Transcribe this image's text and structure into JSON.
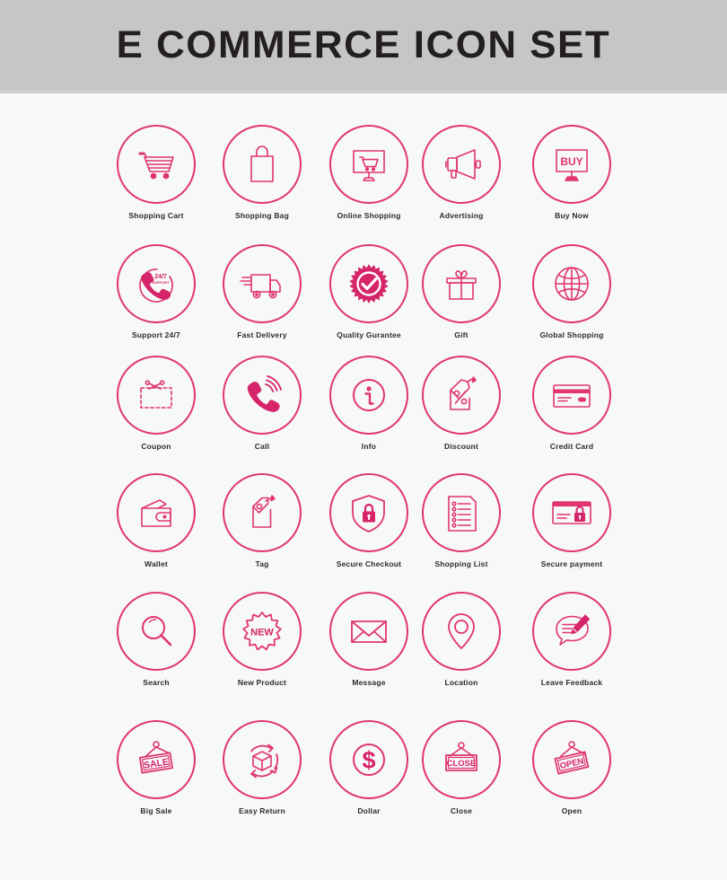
{
  "header": {
    "title": "E COMMERCE ICON SET",
    "background_color": "#c6c6c6",
    "text_color": "#231f20"
  },
  "theme": {
    "accent_color": "#e0356f",
    "accent_dark": "#d6246a",
    "page_background": "#f7f8f8",
    "label_color": "#2b2b2b"
  },
  "grid": {
    "columns": 5,
    "rows": 6,
    "column_centers": [
      174,
      292,
      411,
      514,
      637
    ],
    "row_centers": [
      185,
      318,
      442,
      573,
      705,
      848
    ]
  },
  "icons": [
    {
      "id": "shopping-cart",
      "label": "Shopping Cart",
      "icon": "cart-icon",
      "row": 0,
      "col": 0
    },
    {
      "id": "shopping-bag",
      "label": "Shopping Bag",
      "icon": "bag-icon",
      "row": 0,
      "col": 1
    },
    {
      "id": "online-shopping",
      "label": "Online Shopping",
      "icon": "monitor-cart-icon",
      "row": 0,
      "col": 2
    },
    {
      "id": "advertising",
      "label": "Advertising",
      "icon": "megaphone-icon",
      "row": 0,
      "col": 3
    },
    {
      "id": "buy-now",
      "label": "Buy Now",
      "icon": "monitor-buy-icon",
      "row": 0,
      "col": 4,
      "inner_text": "BUY"
    },
    {
      "id": "support-24-7",
      "label": "Support 24/7",
      "icon": "phone-support-icon",
      "row": 1,
      "col": 0,
      "inner_text": "24/7",
      "inner_text_2": "SUPPORT"
    },
    {
      "id": "fast-delivery",
      "label": "Fast Delivery",
      "icon": "truck-icon",
      "row": 1,
      "col": 1
    },
    {
      "id": "quality-gurantee",
      "label": "Quality Gurantee",
      "icon": "badge-check-icon",
      "row": 1,
      "col": 2
    },
    {
      "id": "gift",
      "label": "Gift",
      "icon": "gift-box-icon",
      "row": 1,
      "col": 3
    },
    {
      "id": "global-shopping",
      "label": "Global Shopping",
      "icon": "globe-icon",
      "row": 1,
      "col": 4
    },
    {
      "id": "coupon",
      "label": "Coupon",
      "icon": "coupon-scissors-icon",
      "row": 2,
      "col": 0
    },
    {
      "id": "call",
      "label": "Call",
      "icon": "phone-ring-icon",
      "row": 2,
      "col": 1
    },
    {
      "id": "info",
      "label": "Info",
      "icon": "info-circle-icon",
      "row": 2,
      "col": 2,
      "inner_text": "i"
    },
    {
      "id": "discount",
      "label": "Discount",
      "icon": "percent-tag-icon",
      "row": 2,
      "col": 3,
      "inner_text": "%"
    },
    {
      "id": "credit-card",
      "label": "Credit Card",
      "icon": "credit-card-icon",
      "row": 2,
      "col": 4
    },
    {
      "id": "wallet",
      "label": "Wallet",
      "icon": "wallet-icon",
      "row": 3,
      "col": 0
    },
    {
      "id": "tag",
      "label": "Tag",
      "icon": "price-tag-icon",
      "row": 3,
      "col": 1
    },
    {
      "id": "secure-checkout",
      "label": "Secure Checkout",
      "icon": "shield-lock-icon",
      "row": 3,
      "col": 2
    },
    {
      "id": "shopping-list",
      "label": "Shopping List",
      "icon": "checklist-icon",
      "row": 3,
      "col": 3
    },
    {
      "id": "secure-payment",
      "label": "Secure payment",
      "icon": "card-lock-icon",
      "row": 3,
      "col": 4
    },
    {
      "id": "search",
      "label": "Search",
      "icon": "magnifier-icon",
      "row": 4,
      "col": 0
    },
    {
      "id": "new-product",
      "label": "New Product",
      "icon": "new-badge-icon",
      "row": 4,
      "col": 1,
      "inner_text": "NEW"
    },
    {
      "id": "message",
      "label": "Message",
      "icon": "envelope-icon",
      "row": 4,
      "col": 2
    },
    {
      "id": "location",
      "label": "Location",
      "icon": "map-pin-icon",
      "row": 4,
      "col": 3
    },
    {
      "id": "leave-feedback",
      "label": "Leave Feedback",
      "icon": "speech-pencil-icon",
      "row": 4,
      "col": 4
    },
    {
      "id": "big-sale",
      "label": "Big Sale",
      "icon": "sale-sign-icon",
      "row": 5,
      "col": 0,
      "inner_text": "SALE"
    },
    {
      "id": "easy-return",
      "label": "Easy Return",
      "icon": "return-box-icon",
      "row": 5,
      "col": 1
    },
    {
      "id": "dollar",
      "label": "Dollar",
      "icon": "dollar-circle-icon",
      "row": 5,
      "col": 2,
      "inner_text": "$"
    },
    {
      "id": "close",
      "label": "Close",
      "icon": "close-sign-icon",
      "row": 5,
      "col": 3,
      "inner_text": "CLOSE"
    },
    {
      "id": "open",
      "label": "Open",
      "icon": "open-sign-icon",
      "row": 5,
      "col": 4,
      "inner_text": "OPEN"
    }
  ]
}
